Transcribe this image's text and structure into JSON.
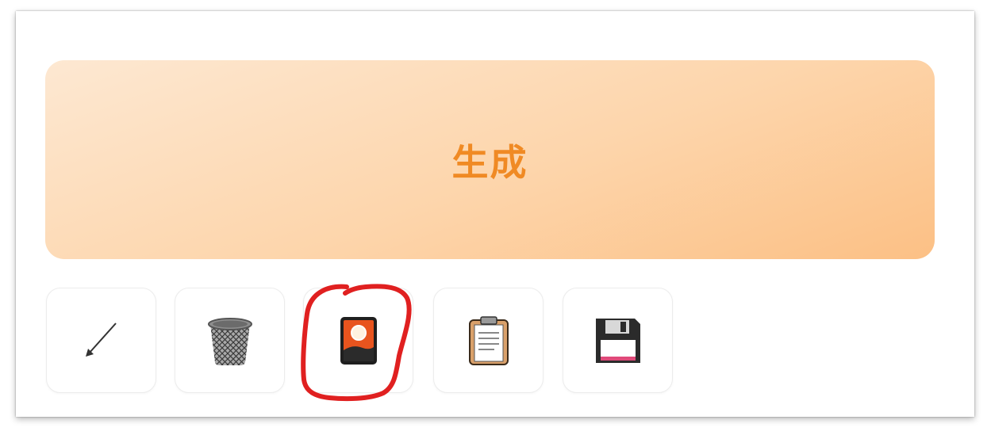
{
  "generate": {
    "label": "生成"
  },
  "tools": [
    {
      "name": "arrow-tool",
      "icon": "arrow-down-left-icon"
    },
    {
      "name": "delete-tool",
      "icon": "trash-can-icon"
    },
    {
      "name": "image-card-tool",
      "icon": "photo-card-icon"
    },
    {
      "name": "clipboard-tool",
      "icon": "clipboard-icon"
    },
    {
      "name": "save-tool",
      "icon": "floppy-disk-icon"
    }
  ],
  "colors": {
    "accent_text": "#f08a24",
    "button_gradient_start": "#fde8d2",
    "button_gradient_end": "#fcc085",
    "annotation": "#e02020"
  }
}
